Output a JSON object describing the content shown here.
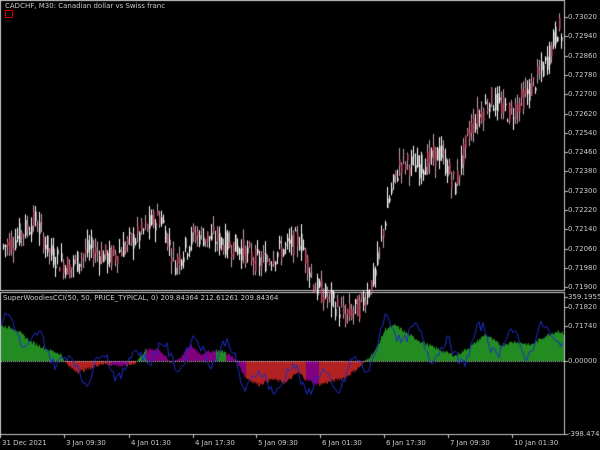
{
  "chart": {
    "title": "CADCHF, M30:  Canadian dollar vs Swiss franc",
    "indicator_title": "SuperWoodiesCCI(50, 50, PRICE_TYPICAL, 0) 209.84364 212.61261 209.84364",
    "price_labels": [
      "0.73020",
      "0.72940",
      "0.72860",
      "0.72780",
      "0.72700",
      "0.72620",
      "0.72540",
      "0.72460",
      "0.72380",
      "0.72300",
      "0.72220",
      "0.72140",
      "0.72060",
      "0.71980",
      "0.71900",
      "0.71820",
      "0.71740"
    ],
    "ind_labels": [
      "359.19552",
      "0.00000",
      "-398.47499"
    ],
    "time_labels": [
      "31 Dec 2021",
      "3 Jan 09:30",
      "4 Jan 01:30",
      "4 Jan 17:30",
      "5 Jan 09:30",
      "6 Jan 01:30",
      "6 Jan 17:30",
      "7 Jan 09:30",
      "10 Jan 01:30"
    ],
    "colors": {
      "bull": "#ffffff",
      "bear": "#c8a0b0",
      "green": "#228b22",
      "red": "#b22222",
      "purple": "#800080",
      "line": "#1e2ec8"
    }
  },
  "chart_data": {
    "type": "candlestick+histogram",
    "price_approx": [
      0.7208,
      0.721,
      0.7212,
      0.7205,
      0.7215,
      0.721,
      0.72,
      0.7195,
      0.7205,
      0.72,
      0.721,
      0.7205,
      0.72,
      0.7198,
      0.721,
      0.7215,
      0.7212,
      0.7205,
      0.7198,
      0.7208,
      0.7215,
      0.721,
      0.7205,
      0.7202,
      0.72,
      0.7195,
      0.7198,
      0.719,
      0.7185,
      0.7178,
      0.7175,
      0.718,
      0.7195,
      0.7215,
      0.7235,
      0.724,
      0.7235,
      0.7245,
      0.7242,
      0.724,
      0.7255,
      0.7265,
      0.727,
      0.7265,
      0.7275,
      0.728,
      0.7285,
      0.729,
      0.73
    ]
  }
}
